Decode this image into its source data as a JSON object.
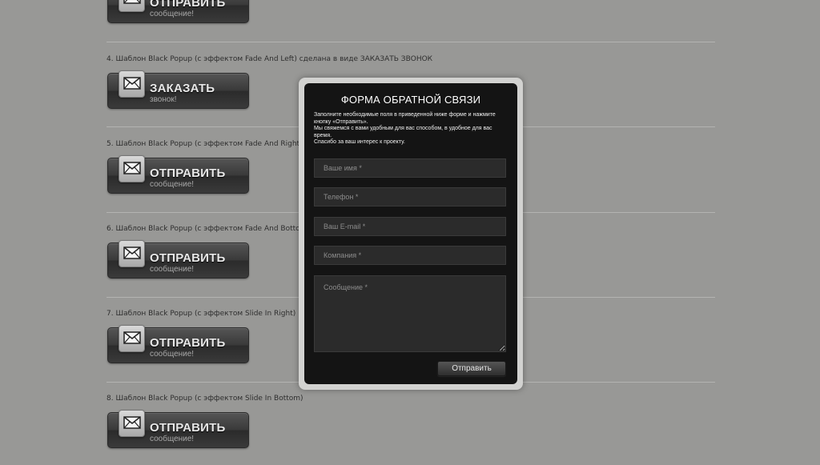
{
  "colors": {
    "page_background": "#989896",
    "popup_frame": "#d2d2d0",
    "popup_background": "#141414",
    "field_background": "#2b2b2b"
  },
  "sections": [
    {
      "title": "",
      "button_main": "ОТПРАВИТЬ",
      "button_sub": "сообщение!",
      "icon": "envelope-icon"
    },
    {
      "title": "4. Шаблон Black Popup (с эффектом Fade And Left) сделана в виде ЗАКАЗАТЬ ЗВОНОК",
      "button_main": "ЗАКАЗАТЬ",
      "button_sub": "звонок!",
      "icon": "envelope-icon"
    },
    {
      "title": "5. Шаблон Black Popup (с эффектом Fade And Right)",
      "button_main": "ОТПРАВИТЬ",
      "button_sub": "сообщение!",
      "icon": "envelope-icon"
    },
    {
      "title": "6. Шаблон Black Popup (с эффектом Fade And Bottom)",
      "button_main": "ОТПРАВИТЬ",
      "button_sub": "сообщение!",
      "icon": "envelope-icon"
    },
    {
      "title": "7. Шаблон Black Popup (с эффектом Slide In Right)",
      "button_main": "ОТПРАВИТЬ",
      "button_sub": "сообщение!",
      "icon": "envelope-icon"
    },
    {
      "title": "8. Шаблон Black Popup (с эффектом Slide In Bottom)",
      "button_main": "ОТПРАВИТЬ",
      "button_sub": "сообщение!",
      "icon": "envelope-icon"
    }
  ],
  "popup": {
    "title": "ФОРМА ОБРАТНОЙ СВЯЗИ",
    "description_lines": [
      "Заполните необходимые поля в приведенной ниже форме и нажмите кнопку «Отправить».",
      "Мы свяжемся с вами удобным для вас способом, в удобное для вас время.",
      "Спасибо за ваш интерес к проекту."
    ],
    "fields": {
      "name": {
        "placeholder": "Ваше имя *",
        "value": ""
      },
      "phone": {
        "placeholder": "Телефон *",
        "value": ""
      },
      "email": {
        "placeholder": "Ваш E-mail *",
        "value": ""
      },
      "company": {
        "placeholder": "Компания *",
        "value": ""
      },
      "message": {
        "placeholder": "Сообщение *",
        "value": ""
      }
    },
    "submit_label": "Отправить"
  }
}
